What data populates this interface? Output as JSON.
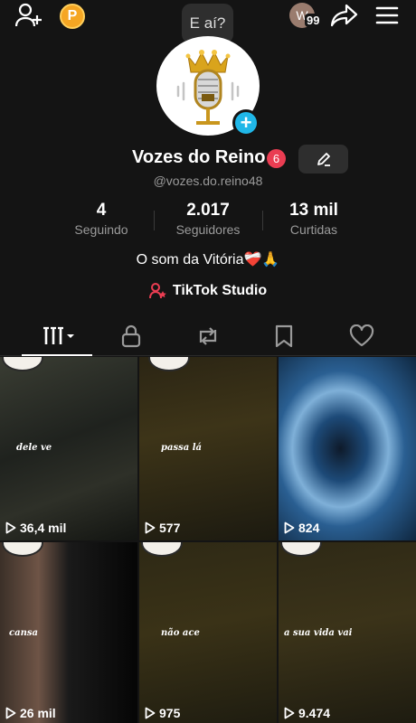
{
  "topbar": {
    "coin_letter": "P",
    "bubble_text": "E aí?",
    "avatar_letter": "W",
    "badge_count": "99"
  },
  "profile": {
    "name": "Vozes do Reino",
    "notif_count": "6",
    "handle": "@vozes.do.reino48",
    "bio": "O som da Vitória❤️‍🩹🙏",
    "studio_label": "TikTok Studio"
  },
  "stats": [
    {
      "num": "4",
      "label": "Seguindo"
    },
    {
      "num": "2.017",
      "label": "Seguidores"
    },
    {
      "num": "13 mil",
      "label": "Curtidas"
    }
  ],
  "videos": [
    {
      "overlay": "dele ve",
      "views": "36,4 mil"
    },
    {
      "overlay": "passa lá",
      "views": "577"
    },
    {
      "overlay": "",
      "views": "824"
    },
    {
      "overlay": "cansa",
      "views": "26 mil"
    },
    {
      "overlay": "não ace",
      "views": "975"
    },
    {
      "overlay": "a sua vida vai",
      "views": "9.474"
    }
  ],
  "colors": {
    "background": "#141414",
    "accent_blue": "#20b7e8",
    "notif_red": "#ea3d52",
    "coin_orange": "#f5a623"
  }
}
